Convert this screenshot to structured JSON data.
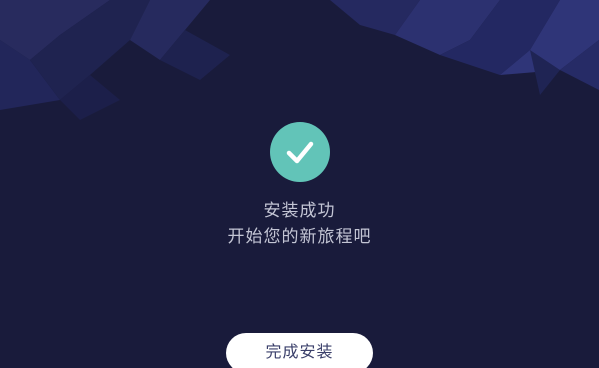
{
  "status": {
    "icon": "check-icon",
    "title": "安装成功",
    "subtitle": "开始您的新旅程吧"
  },
  "actions": {
    "finish_label": "完成安装"
  },
  "colors": {
    "background": "#191b3b",
    "accent": "#62c4b8",
    "text": "#c3c5d4",
    "button_bg": "#ffffff",
    "button_text": "#3a3f6a"
  }
}
